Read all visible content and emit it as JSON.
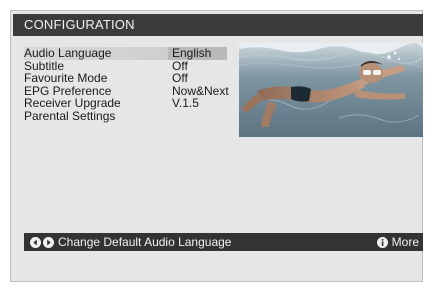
{
  "title": "CONFIGURATION",
  "menu": [
    {
      "label": "Audio Language",
      "value": "English",
      "selected": true
    },
    {
      "label": "Subtitle",
      "value": "Off",
      "selected": false
    },
    {
      "label": "Favourite Mode",
      "value": "Off",
      "selected": false
    },
    {
      "label": "EPG Preference",
      "value": "Now&Next",
      "selected": false
    },
    {
      "label": "Receiver Upgrade",
      "value": "V.1.5",
      "selected": false
    },
    {
      "label": "Parental Settings",
      "value": "",
      "selected": false
    }
  ],
  "hint": {
    "left_icons": [
      "left-arrow-circle-icon",
      "right-arrow-circle-icon"
    ],
    "left_text": "Change Default Audio Language",
    "right_icon": "info-circle-icon",
    "right_text": "More"
  },
  "colors": {
    "title_bar": "#3b3b3b",
    "panel": "#e6e6e6",
    "highlight": "#b9b9b9",
    "hint_bar": "#333333"
  }
}
